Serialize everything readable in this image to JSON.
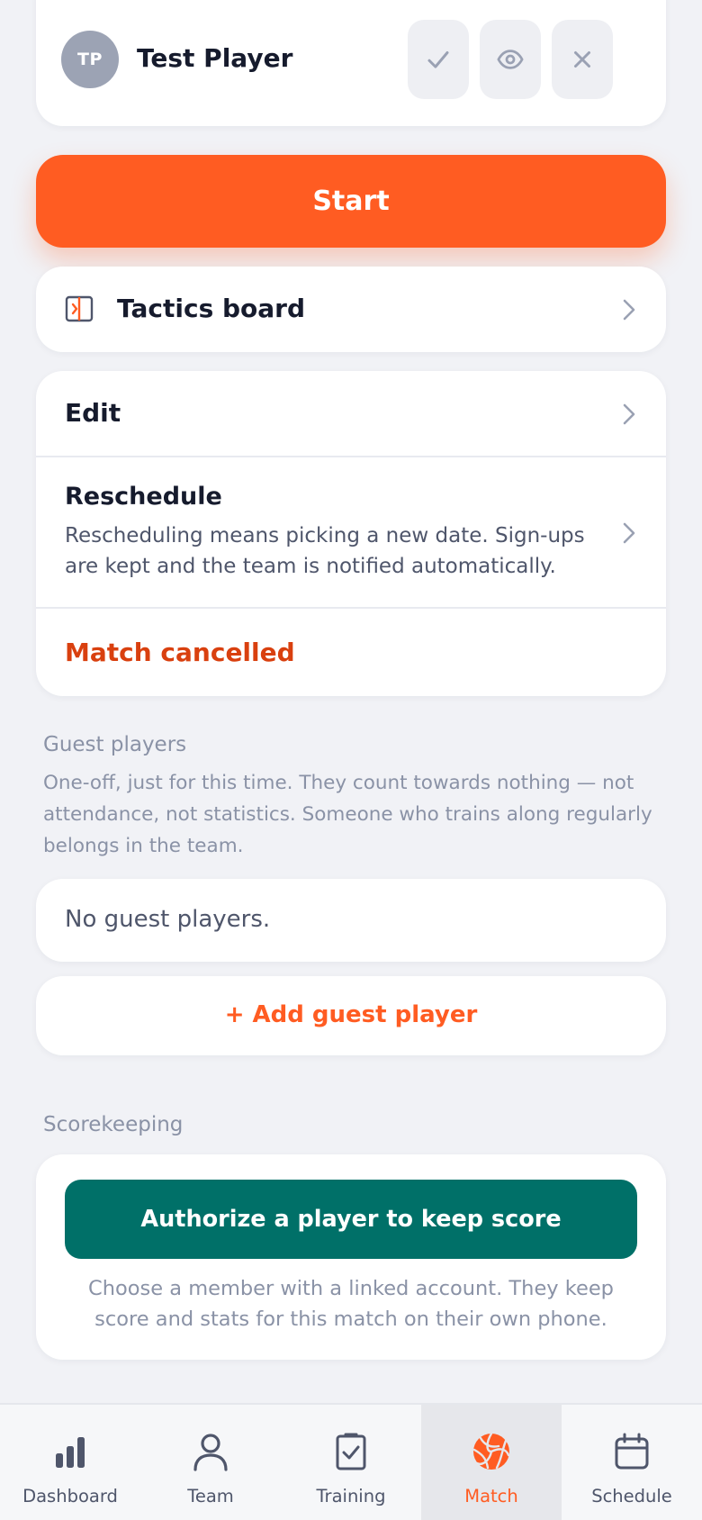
{
  "player": {
    "initials": "TP",
    "name": "Test Player",
    "actions": [
      "check-icon",
      "eye-icon",
      "close-icon"
    ]
  },
  "start_label": "Start",
  "tactics": {
    "label": "Tactics board",
    "icon": "tactics-board-icon"
  },
  "actions": {
    "edit_label": "Edit",
    "reschedule_label": "Reschedule",
    "reschedule_desc": "Rescheduling means picking a new date. Sign-ups are kept and the team is notified automatically.",
    "cancel_label": "Match cancelled"
  },
  "guests": {
    "title": "Guest players",
    "description": "One-off, just for this time. They count towards nothing — not attendance, not statistics. Someone who trains along regularly belongs in the team.",
    "empty_label": "No guest players.",
    "add_label": "+ Add guest player"
  },
  "scorekeeping": {
    "title": "Scorekeeping",
    "button_label": "Authorize a player to keep score",
    "note": "Choose a member with a linked account. They keep score and stats for this match on their own phone."
  },
  "nav": {
    "items": [
      {
        "label": "Dashboard",
        "icon": "bar-chart-icon"
      },
      {
        "label": "Team",
        "icon": "person-icon"
      },
      {
        "label": "Training",
        "icon": "clipboard-check-icon"
      },
      {
        "label": "Match",
        "icon": "volleyball-icon"
      },
      {
        "label": "Schedule",
        "icon": "calendar-icon"
      }
    ],
    "active": "Match"
  },
  "colors": {
    "accent": "#ff5c22",
    "danger": "#d9400f",
    "teal": "#007068",
    "background": "#f1f2f6"
  }
}
